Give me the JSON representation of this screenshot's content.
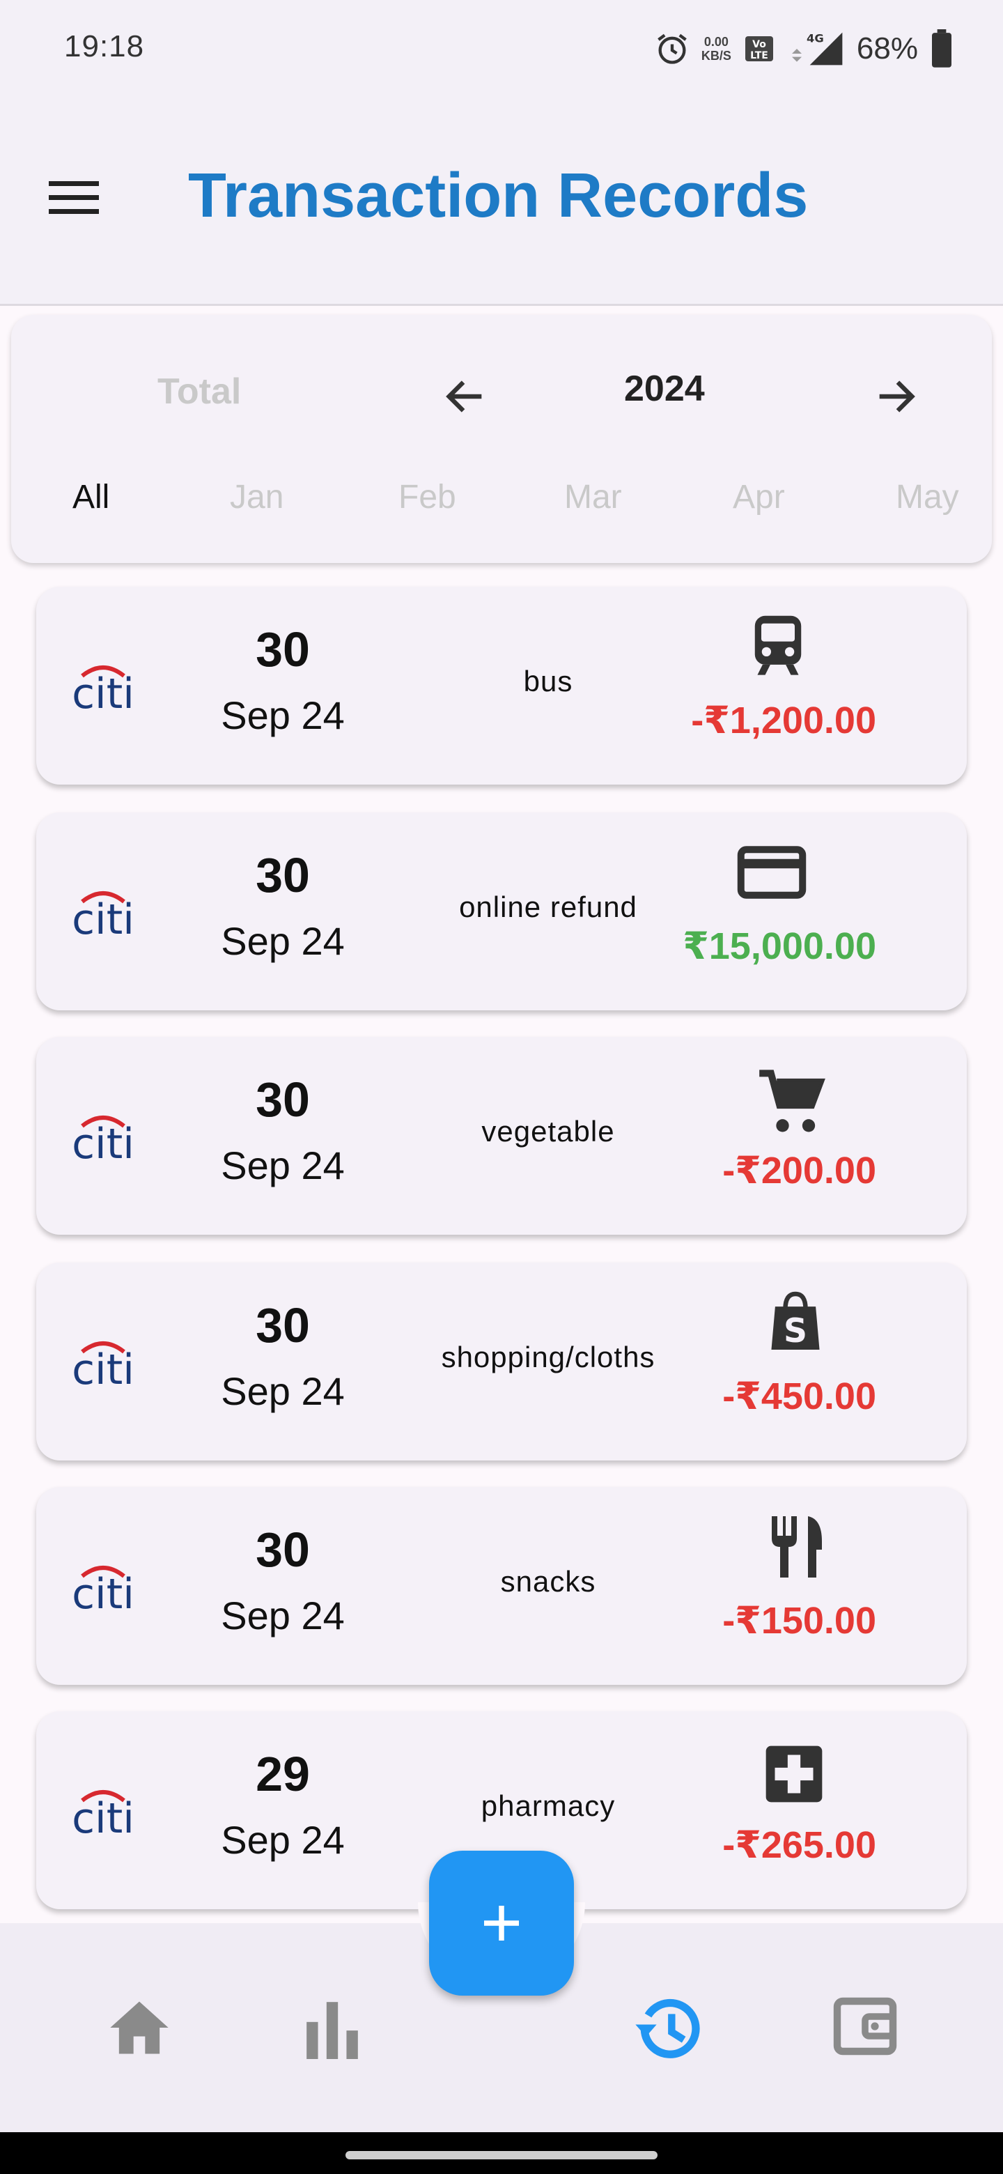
{
  "status_bar": {
    "time": "19:18",
    "net_speed_value": "0.00",
    "net_speed_unit": "KB/S",
    "volte": "Vo LTE",
    "network": "4G",
    "battery": "68%"
  },
  "app_bar": {
    "title": "Transaction Records",
    "menu_icon": "menu-icon"
  },
  "filter": {
    "total_label": "Total",
    "year": "2024",
    "months": [
      {
        "label": "All",
        "active": true
      },
      {
        "label": "Jan",
        "active": false
      },
      {
        "label": "Feb",
        "active": false
      },
      {
        "label": "Mar",
        "active": false
      },
      {
        "label": "Apr",
        "active": false
      },
      {
        "label": "May",
        "active": false
      }
    ]
  },
  "transactions": [
    {
      "bank": "citi",
      "day": "30",
      "month_year": "Sep 24",
      "description": "bus",
      "icon": "train-icon",
      "amount": "-₹1,200.00",
      "type": "debit"
    },
    {
      "bank": "citi",
      "day": "30",
      "month_year": "Sep 24",
      "description": "online refund",
      "icon": "credit-card-icon",
      "amount": "₹15,000.00",
      "type": "credit"
    },
    {
      "bank": "citi",
      "day": "30",
      "month_year": "Sep 24",
      "description": "vegetable",
      "icon": "shopping-cart-icon",
      "amount": "-₹200.00",
      "type": "debit"
    },
    {
      "bank": "citi",
      "day": "30",
      "month_year": "Sep 24",
      "description": "shopping/cloths",
      "icon": "shopping-bag-icon",
      "amount": "-₹450.00",
      "type": "debit"
    },
    {
      "bank": "citi",
      "day": "30",
      "month_year": "Sep 24",
      "description": "snacks",
      "icon": "restaurant-icon",
      "amount": "-₹150.00",
      "type": "debit"
    },
    {
      "bank": "citi",
      "day": "29",
      "month_year": "Sep 24",
      "description": "pharmacy",
      "icon": "medical-icon",
      "amount": "-₹265.00",
      "type": "debit"
    }
  ],
  "colors": {
    "primary": "#1E7BC6",
    "fab": "#2196F3",
    "debit": "#E53935",
    "credit": "#4CAF50",
    "nav_inactive": "#8A8A8A",
    "nav_active": "#2196F3"
  },
  "bottom_nav": [
    {
      "icon": "home-icon",
      "active": false
    },
    {
      "icon": "bar-chart-icon",
      "active": false
    },
    {
      "icon": "history-icon",
      "active": true
    },
    {
      "icon": "wallet-icon",
      "active": false
    }
  ],
  "fab": {
    "icon": "plus-icon"
  }
}
